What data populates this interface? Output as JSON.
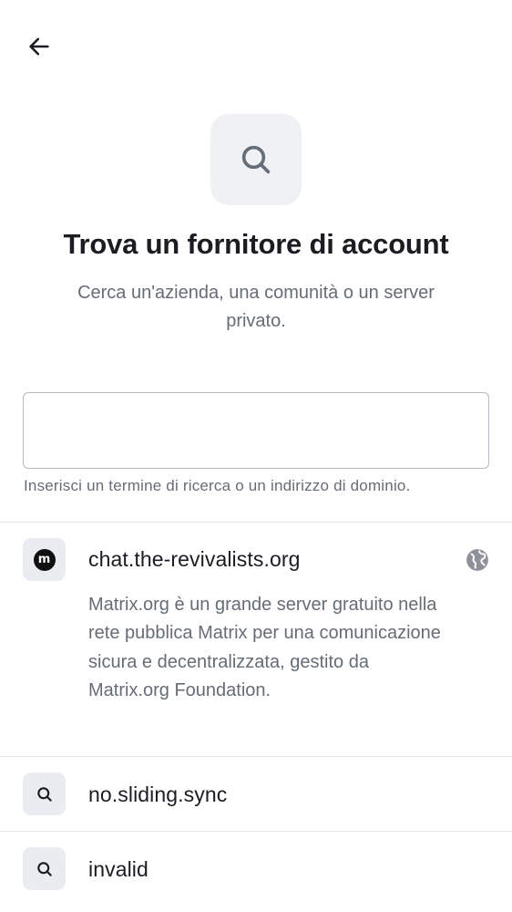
{
  "header": {
    "back_icon": "arrow-left-icon"
  },
  "hero": {
    "icon": "search-icon",
    "title": "Trova un fornitore di account",
    "subtitle": "Cerca un'azienda, una comunità o un server privato."
  },
  "search": {
    "value": "",
    "placeholder": "",
    "helper_text": "Inserisci un termine di ricerca o un indirizzo di dominio."
  },
  "results": [
    {
      "icon": "matrix-logo-icon",
      "logo_text": "m",
      "title": "chat.the-revivalists.org",
      "description": "Matrix.org è un grande server gratuito nella rete pubblica Matrix per una comunicazione sicura e decentralizzata, gestito da Matrix.org Foundation.",
      "trailing_icon": "globe-icon"
    },
    {
      "icon": "search-icon",
      "title": "no.sliding.sync"
    },
    {
      "icon": "search-icon",
      "title": "invalid"
    }
  ],
  "colors": {
    "text_primary": "#1b1d22",
    "text_secondary": "#656d77",
    "icon_bg": "#eff1f5",
    "divider": "#e4e6ea",
    "input_border": "#b6bac2"
  }
}
